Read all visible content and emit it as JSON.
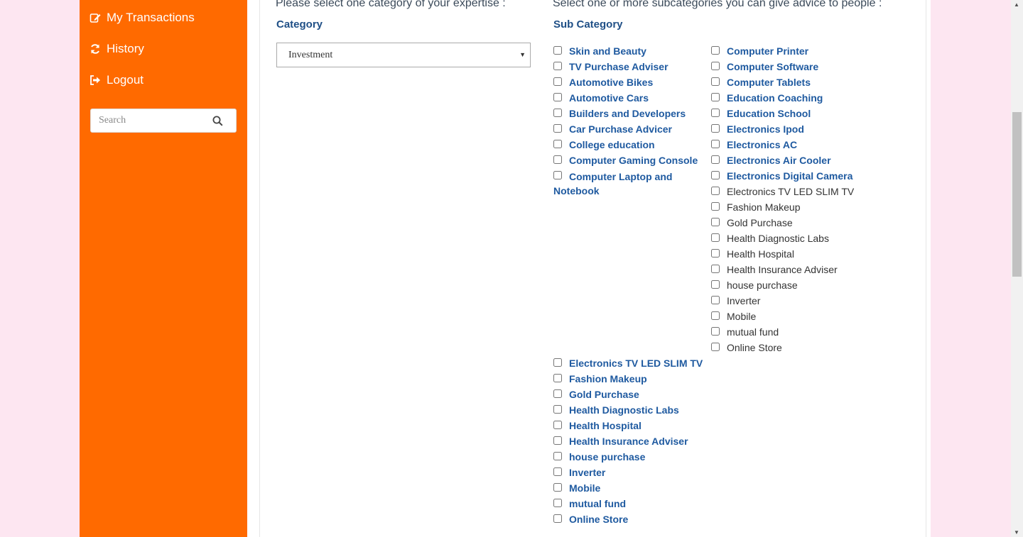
{
  "sidebar": {
    "items": [
      {
        "label": "My Transactions",
        "icon": "edit-icon"
      },
      {
        "label": "History",
        "icon": "refresh-icon"
      },
      {
        "label": "Logout",
        "icon": "signout-icon"
      }
    ],
    "search_placeholder": "Search"
  },
  "main": {
    "category_heading": "Please select one category of your expertise :",
    "subcategory_heading": "Select one or more subcategories you can give advice to people :",
    "category_label": "Category",
    "subcategory_label": "Sub Category",
    "category_selected": "Investment",
    "col1": [
      "Skin and Beauty",
      "TV Purchase Adviser",
      "Automotive Bikes",
      "Automotive Cars",
      "Builders and Developers",
      "Car Purchase Advicer",
      "College education",
      "Computer Gaming Console",
      "Computer Laptop and Notebook"
    ],
    "col2_bold": [
      "Computer Printer",
      "Computer Software",
      "Computer Tablets",
      "Education Coaching",
      "Education School",
      "Electronics Ipod",
      "Electronics AC",
      "Electronics Air Cooler",
      "Electronics Digital Camera"
    ],
    "col2_normal": [
      "Electronics TV LED SLIM TV",
      "Fashion Makeup",
      "Gold Purchase",
      "Health Diagnostic Labs",
      "Health Hospital",
      "Health Insurance Adviser",
      "house purchase",
      "Inverter",
      "Mobile",
      "mutual fund",
      "Online Store"
    ],
    "col1_lower": [
      "Electronics TV LED SLIM TV",
      "Fashion Makeup",
      "Gold Purchase",
      "Health Diagnostic Labs",
      "Health Hospital",
      "Health Insurance Adviser",
      "house purchase",
      "Inverter",
      "Mobile",
      "mutual fund",
      "Online Store"
    ]
  }
}
